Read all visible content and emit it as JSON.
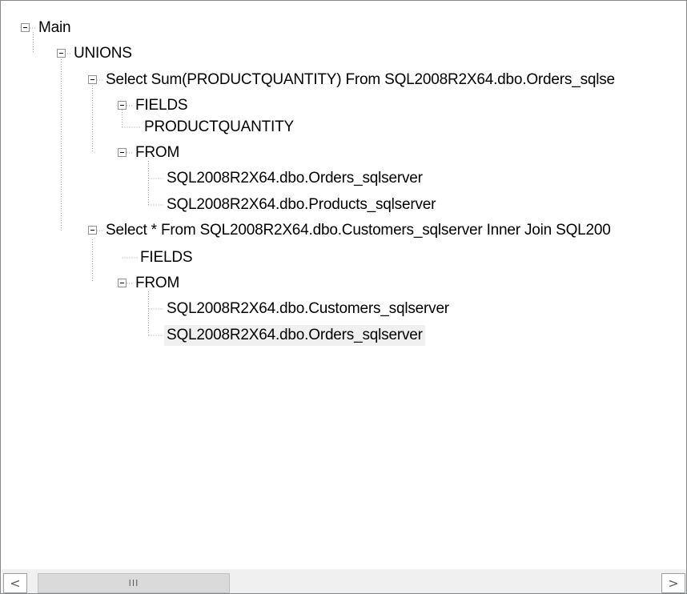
{
  "tree": {
    "main": "Main",
    "unions": "UNIONS",
    "select1": "Select Sum(PRODUCTQUANTITY) From SQL2008R2X64.dbo.Orders_sqlse",
    "select1_fields": "FIELDS",
    "select1_fields_item": "PRODUCTQUANTITY",
    "select1_from": "FROM",
    "select1_from_item1": "SQL2008R2X64.dbo.Orders_sqlserver",
    "select1_from_item2": "SQL2008R2X64.dbo.Products_sqlserver",
    "select2": "Select * From SQL2008R2X64.dbo.Customers_sqlserver Inner Join SQL200",
    "select2_fields": "FIELDS",
    "select2_from": "FROM",
    "select2_from_item1": "SQL2008R2X64.dbo.Customers_sqlserver",
    "select2_from_item2": "SQL2008R2X64.dbo.Orders_sqlserver"
  },
  "scrollbar": {
    "left_glyph": "<",
    "right_glyph": ">",
    "thumb_grip": "III"
  }
}
